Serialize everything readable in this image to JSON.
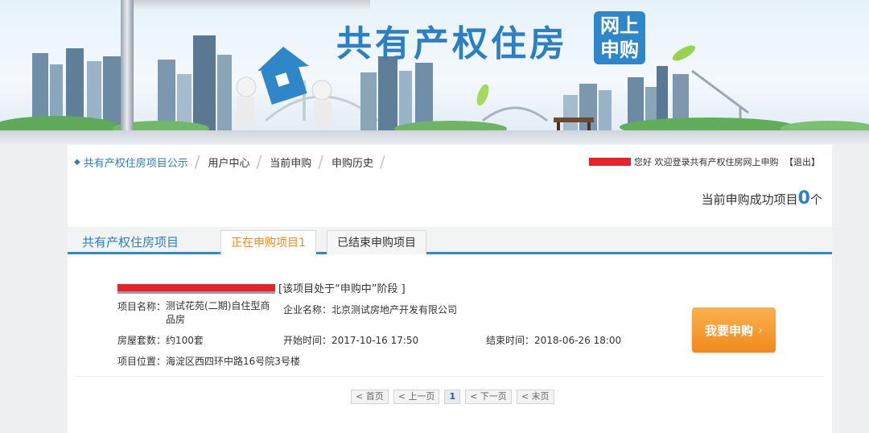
{
  "banner": {
    "title": "共有产权住房",
    "badge_line1": "网上",
    "badge_line2": "申购"
  },
  "nav": {
    "items": [
      {
        "label": "共有产权住房项目公示",
        "active": true
      },
      {
        "label": "用户中心",
        "active": false
      },
      {
        "label": "当前申购",
        "active": false
      },
      {
        "label": "申购历史",
        "active": false
      }
    ],
    "welcome": "您好 欢迎登录共有产权住房网上申购",
    "logout": "【退出】"
  },
  "success": {
    "label": "当前申购成功项目",
    "count": "0",
    "unit": "个"
  },
  "tabs": {
    "section_title": "共有产权住房项目",
    "active_label": "正在申购项目1",
    "other_label": "已结束申购项目"
  },
  "project": {
    "status": "[该项目处于“申购中”阶段 ]",
    "name_label": "项目名称：",
    "name_value": "测试花苑(二期)自住型商品房",
    "company_label": "企业名称：",
    "company_value": "北京测试房地产开发有限公司",
    "units_label": "房屋套数：",
    "units_value": "约100套",
    "start_label": "开始时间：",
    "start_value": "2017-10-16 17:50",
    "end_label": "结束时间：",
    "end_value": "2018-06-26 18:00",
    "location_label": "项目位置：",
    "location_value": "海淀区西四环中路16号院3号楼",
    "apply_label": "我要申购",
    "apply_chevron": "›"
  },
  "pager": {
    "first": "< 首页",
    "prev": "< 上一页",
    "current": "1",
    "next": "< 下一页",
    "last": "< 末页"
  },
  "colors": {
    "accent_blue": "#2d7fc4",
    "accent_orange": "#f08a1c",
    "redaction_red": "#e8222c"
  }
}
